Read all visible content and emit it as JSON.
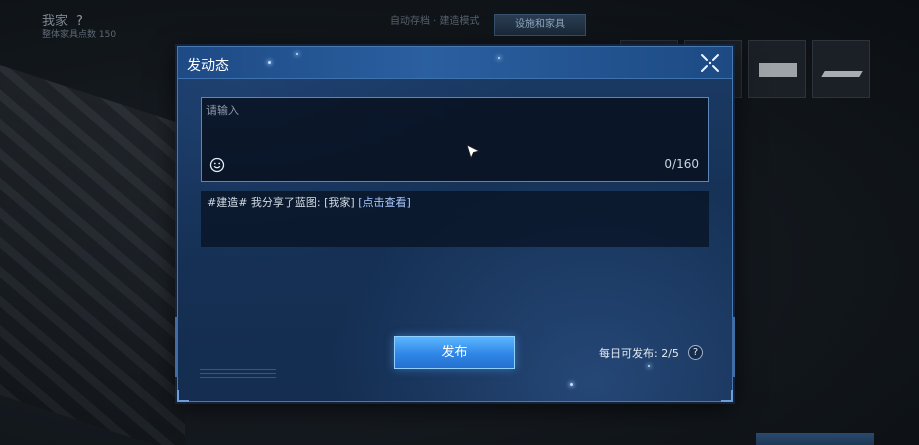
{
  "background": {
    "title": "我家",
    "title_hint": "?",
    "subtitle": "整体家具点数 150",
    "center_text": "自动存档 · 建造模式",
    "tab_label": "设施和家具"
  },
  "dialog": {
    "title": "发动态",
    "input": {
      "placeholder": "请输入",
      "value": "",
      "char_count": "0/160"
    },
    "share": {
      "prefix": "#建造# 我分享了蓝图: [我家]",
      "link": "[点击查看]"
    },
    "publish_label": "发布",
    "daily_limit": "每日可发布: 2/5",
    "help_label": "?"
  },
  "colors": {
    "dialog_bg": "#163257",
    "header_bg": "#2a5fa0",
    "button_accent": "#2f86e6"
  }
}
